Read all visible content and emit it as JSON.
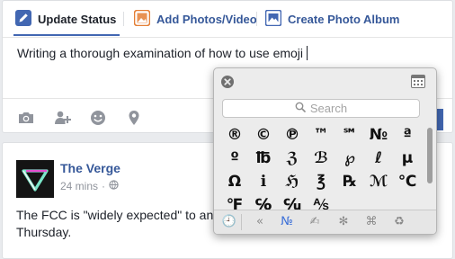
{
  "composer": {
    "tabs": [
      {
        "label": "Update Status",
        "icon": "pencil-icon"
      },
      {
        "label": "Add Photos/Video",
        "icon": "photo-icon"
      },
      {
        "label": "Create Photo Album",
        "icon": "album-icon"
      }
    ],
    "text": "Writing a thorough examination of how to use emoji",
    "tools": [
      "camera-icon",
      "tag-friends-icon",
      "feeling-icon",
      "location-icon"
    ],
    "colors": {
      "brand": "#4267b2",
      "link": "#365899",
      "tab_icon_orange": "#e47f36"
    }
  },
  "story": {
    "name": "The Verge",
    "time": "24 mins",
    "privacy_icon": "globe-icon",
    "body_lines": [
      "The FCC is \"widely expected\" to an",
      "Thursday."
    ]
  },
  "picker": {
    "search_placeholder": "Search",
    "symbols": [
      [
        "®",
        "©",
        "℗",
        "™",
        "℠",
        "№",
        "ª"
      ],
      [
        "º",
        "℔",
        "ℨ",
        "ℬ",
        "℘",
        "ℓ",
        "µ"
      ],
      [
        "Ω",
        "ℹ",
        "ℌ",
        "℥",
        "℞",
        "ℳ",
        "℃"
      ],
      [
        "℉",
        "℅",
        "℆",
        "⅍"
      ]
    ],
    "categories": [
      {
        "glyph": "🕘",
        "name": "recents-icon"
      },
      {
        "glyph": "«",
        "name": "punctuation-icon"
      },
      {
        "glyph": "№",
        "name": "letterlike-icon",
        "active": true
      },
      {
        "glyph": "✍",
        "name": "pictographs-icon"
      },
      {
        "glyph": "✻",
        "name": "stars-icon"
      },
      {
        "glyph": "⌘",
        "name": "technical-icon"
      },
      {
        "glyph": "♻",
        "name": "signs-icon"
      }
    ]
  }
}
